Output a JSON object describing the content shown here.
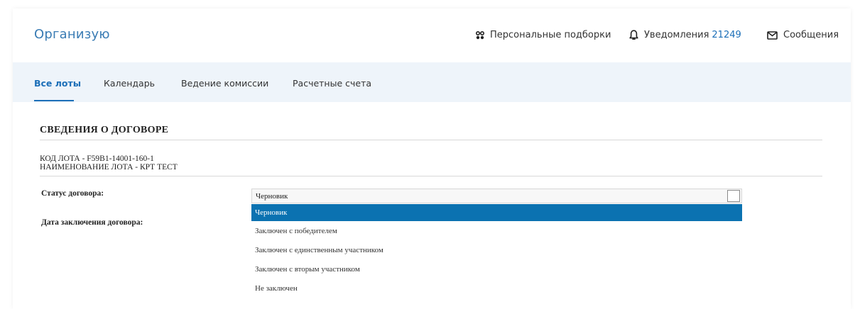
{
  "header": {
    "brand": "Организую",
    "personal_selections": "Персональные подборки",
    "notifications_label": "Уведомления",
    "notifications_count": "21249",
    "messages": "Сообщения"
  },
  "nav": {
    "tabs": [
      {
        "label": "Все лоты",
        "active": true
      },
      {
        "label": "Календарь",
        "active": false
      },
      {
        "label": "Ведение комиссии",
        "active": false
      },
      {
        "label": "Расчетные счета",
        "active": false
      }
    ]
  },
  "content": {
    "section_title": "СВЕДЕНИЯ О ДОГОВОРЕ",
    "lot_code": "КОД ЛОТА - F59B1-14001-160-1",
    "lot_name": "НАИМЕНОВАНИЕ ЛОТА - КРТ ТЕСТ",
    "status_label": "Статус договора:",
    "date_label": "Дата заключения договора:",
    "status_select": {
      "value": "Черновик",
      "options": [
        "Черновик",
        "Заключен с победителем",
        "Заключен с единственным участником",
        "Заключен с вторым участником",
        "Не заключен"
      ],
      "highlighted_option": "Черновик"
    }
  },
  "colors": {
    "brand": "#3a7cb4",
    "accent": "#1c6fb8",
    "nav_bg": "#eef4fa",
    "highlight": "#0b72b1"
  }
}
